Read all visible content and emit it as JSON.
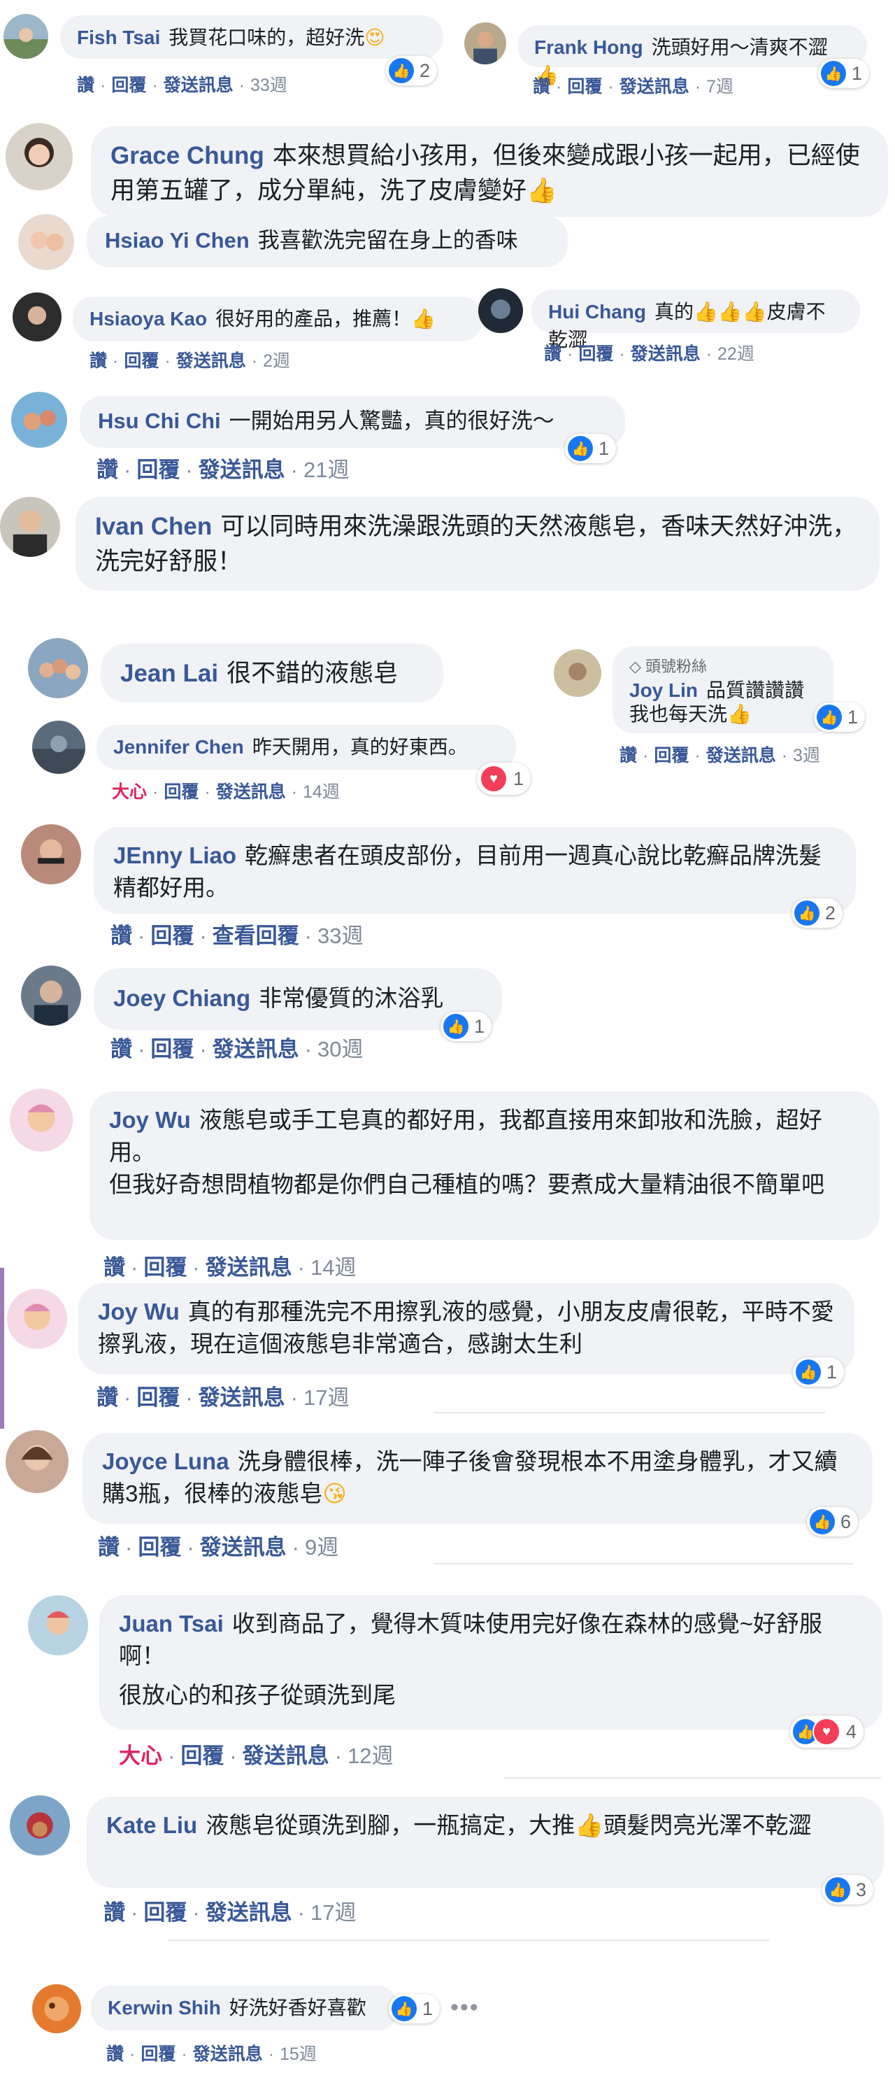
{
  "actions": {
    "like": "讚",
    "reply": "回覆",
    "send_message": "發送訊息",
    "love": "大心",
    "view_replies": "查看回覆",
    "separator": "·"
  },
  "badge": {
    "top_fan": "頭號粉絲"
  },
  "colors": {
    "name": "#385898",
    "bubble": "#f0f2f5",
    "like": "#1877f2",
    "love": "#f33e58"
  },
  "comments": [
    {
      "id": "fish-tsai",
      "name": "Fish Tsai",
      "text": "我買花口味的，超好洗",
      "emoji": "😍",
      "time": "33週",
      "reactions": "2"
    },
    {
      "id": "frank-hong",
      "name": "Frank Hong",
      "text": "洗頭好用～清爽不澀",
      "emoji": "👍",
      "time": "7週",
      "reactions": "1"
    },
    {
      "id": "grace-chung",
      "name": "Grace Chung",
      "text": "本來想買給小孩用，但後來變成跟小孩一起用，已經使用第五罐了，成分單純，洗了皮膚變好",
      "emoji": "👍"
    },
    {
      "id": "hsiao-yi-chen",
      "name": "Hsiao Yi Chen",
      "text": "我喜歡洗完留在身上的香味"
    },
    {
      "id": "hsiaoya-kao",
      "name": "Hsiaoya Kao",
      "text": "很好用的產品，推薦！",
      "emoji": "👍",
      "time": "2週"
    },
    {
      "id": "hui-chang",
      "name": "Hui Chang",
      "text_before": "真的",
      "emoji": "👍👍👍",
      "text_after": "皮膚不乾澀",
      "time": "22週"
    },
    {
      "id": "hsu-chi-chi",
      "name": "Hsu Chi Chi",
      "text": "一開始用另人驚豔，真的很好洗～",
      "time": "21週",
      "reactions": "1"
    },
    {
      "id": "ivan-chen",
      "name": "Ivan Chen",
      "text": "可以同時用來洗澡跟洗頭的天然液態皂，香味天然好沖洗，洗完好舒服！"
    },
    {
      "id": "jean-lai",
      "name": "Jean Lai",
      "text": "很不錯的液態皂"
    },
    {
      "id": "joy-lin",
      "name": "Joy Lin",
      "text": "品質讚讚讚",
      "text2": "我也每天洗",
      "emoji": "👍",
      "time": "3週",
      "reactions": "1"
    },
    {
      "id": "jennifer-chen",
      "name": "Jennifer Chen",
      "text": "昨天開用，真的好東西。",
      "time": "14週",
      "reactions": "1"
    },
    {
      "id": "jenny-liao",
      "name": "JEnny Liao",
      "text": "乾癬患者在頭皮部份，目前用一週真心說比乾癬品牌洗髮精都好用。",
      "time": "33週",
      "reactions": "2"
    },
    {
      "id": "joey-chiang",
      "name": "Joey Chiang",
      "text": "非常優質的沐浴乳",
      "time": "30週",
      "reactions": "1"
    },
    {
      "id": "joy-wu-1",
      "name": "Joy Wu",
      "text": "液態皂或手工皂真的都好用，我都直接用來卸妝和洗臉，超好用。",
      "text2": "但我好奇想問植物都是你們自己種植的嗎？要煮成大量精油很不簡單吧",
      "time": "14週"
    },
    {
      "id": "joy-wu-2",
      "name": "Joy Wu",
      "text": "真的有那種洗完不用擦乳液的感覺，小朋友皮膚很乾，平時不愛擦乳液，現在這個液態皂非常適合，感謝太生利",
      "time": "17週",
      "reactions": "1"
    },
    {
      "id": "joyce-luna",
      "name": "Joyce Luna",
      "text": "洗身體很棒，洗一陣子後會發現根本不用塗身體乳，才又續購3瓶，很棒的液態皂",
      "emoji": "😘",
      "time": "9週",
      "reactions": "6"
    },
    {
      "id": "juan-tsai",
      "name": "Juan Tsai",
      "text": "收到商品了，覺得木質味使用完好像在森林的感覺~好舒服啊！",
      "text2": "很放心的和孩子從頭洗到尾",
      "time": "12週",
      "reactions": "4"
    },
    {
      "id": "kate-liu",
      "name": "Kate Liu",
      "text_before": "液態皂從頭洗到腳，一瓶搞定，大推",
      "emoji": "👍",
      "text_after": "頭髮閃亮光澤不乾澀",
      "time": "17週",
      "reactions": "3"
    },
    {
      "id": "kerwin-shih",
      "name": "Kerwin Shih",
      "text": "好洗好香好喜歡",
      "time": "15週",
      "reactions": "1"
    }
  ],
  "more_icon": "more-options-icon"
}
